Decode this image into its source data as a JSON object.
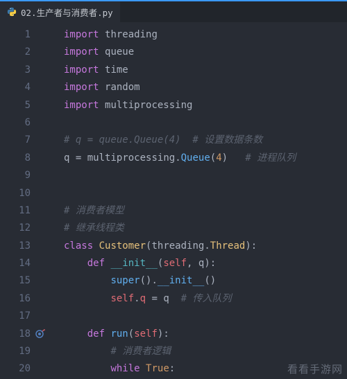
{
  "tab": {
    "title": "02.生产者与消费者.py",
    "icon": "python-icon"
  },
  "lineStart": 1,
  "lineCount": 20,
  "circle_line": 18,
  "code": [
    [
      [
        "kw",
        "import"
      ],
      [
        "sp",
        " "
      ],
      [
        "ident",
        "threading"
      ]
    ],
    [
      [
        "kw",
        "import"
      ],
      [
        "sp",
        " "
      ],
      [
        "ident",
        "queue"
      ]
    ],
    [
      [
        "kw",
        "import"
      ],
      [
        "sp",
        " "
      ],
      [
        "ident",
        "time"
      ]
    ],
    [
      [
        "kw",
        "import"
      ],
      [
        "sp",
        " "
      ],
      [
        "ident",
        "random"
      ]
    ],
    [
      [
        "kw",
        "import"
      ],
      [
        "sp",
        " "
      ],
      [
        "ident",
        "multiprocessing"
      ]
    ],
    [],
    [
      [
        "cmt",
        "# q = queue.Queue(4)  # 设置数据条数"
      ]
    ],
    [
      [
        "ident",
        "q"
      ],
      [
        "sp",
        " "
      ],
      [
        "op",
        "="
      ],
      [
        "sp",
        " "
      ],
      [
        "ident",
        "multiprocessing"
      ],
      [
        "op",
        "."
      ],
      [
        "fn",
        "Queue"
      ],
      [
        "op",
        "("
      ],
      [
        "num",
        "4"
      ],
      [
        "op",
        ")"
      ],
      [
        "sp",
        "   "
      ],
      [
        "cmt",
        "# 进程队列"
      ]
    ],
    [],
    [],
    [
      [
        "cmt",
        "# 消费者模型"
      ]
    ],
    [
      [
        "cmt",
        "# 继承线程类"
      ]
    ],
    [
      [
        "kw",
        "class"
      ],
      [
        "sp",
        " "
      ],
      [
        "cls",
        "Customer"
      ],
      [
        "op",
        "("
      ],
      [
        "ident",
        "threading"
      ],
      [
        "op",
        "."
      ],
      [
        "cls",
        "Thread"
      ],
      [
        "op",
        "):"
      ]
    ],
    [
      [
        "sp",
        "    "
      ],
      [
        "kw",
        "def"
      ],
      [
        "sp",
        " "
      ],
      [
        "dunder",
        "__init__"
      ],
      [
        "op",
        "("
      ],
      [
        "self",
        "self"
      ],
      [
        "op",
        ", "
      ],
      [
        "ident",
        "q"
      ],
      [
        "op",
        "):"
      ]
    ],
    [
      [
        "sp",
        "        "
      ],
      [
        "fn",
        "super"
      ],
      [
        "op",
        "()"
      ],
      [
        "op",
        "."
      ],
      [
        "fn",
        "__init__"
      ],
      [
        "op",
        "()"
      ]
    ],
    [
      [
        "sp",
        "        "
      ],
      [
        "self",
        "self"
      ],
      [
        "op",
        "."
      ],
      [
        "attr",
        "q"
      ],
      [
        "sp",
        " "
      ],
      [
        "op",
        "="
      ],
      [
        "sp",
        " "
      ],
      [
        "ident",
        "q"
      ],
      [
        "sp",
        "  "
      ],
      [
        "cmt",
        "# 传入队列"
      ]
    ],
    [],
    [
      [
        "sp",
        "    "
      ],
      [
        "kw",
        "def"
      ],
      [
        "sp",
        " "
      ],
      [
        "fn",
        "run"
      ],
      [
        "op",
        "("
      ],
      [
        "self",
        "self"
      ],
      [
        "op",
        "):"
      ]
    ],
    [
      [
        "sp",
        "        "
      ],
      [
        "cmt",
        "# 消费者逻辑"
      ]
    ],
    [
      [
        "sp",
        "        "
      ],
      [
        "kw",
        "while"
      ],
      [
        "sp",
        " "
      ],
      [
        "bool",
        "True"
      ],
      [
        "op",
        ":"
      ]
    ]
  ],
  "watermark": "看看手游网"
}
